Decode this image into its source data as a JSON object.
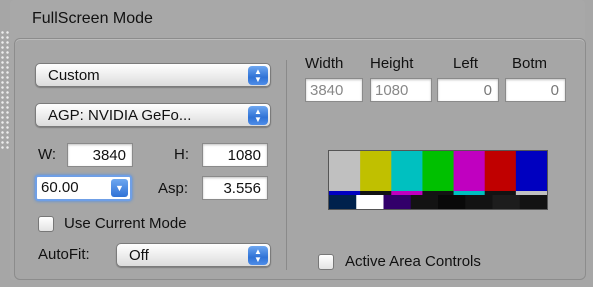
{
  "panel": {
    "title": "FullScreen Mode"
  },
  "mode_popup": {
    "value": "Custom"
  },
  "gpu_popup": {
    "value": "AGP: NVIDIA GeFo..."
  },
  "width": {
    "label": "W:",
    "value": "3840"
  },
  "height": {
    "label": "H:",
    "value": "1080"
  },
  "refresh": {
    "value": "60.00"
  },
  "aspect": {
    "label": "Asp:",
    "value": "3.556"
  },
  "use_current_mode": {
    "label": "Use Current Mode",
    "checked": false
  },
  "autofit": {
    "label": "AutoFit:",
    "value": "Off"
  },
  "columns": {
    "width": "Width",
    "height": "Height",
    "left": "Left",
    "botm": "Botm"
  },
  "column_values": {
    "width": "3840",
    "height": "1080",
    "left": "0",
    "botm": "0"
  },
  "active_area": {
    "label": "Active Area Controls",
    "checked": false
  },
  "color_bars": {
    "top": [
      "#c0c0c0",
      "#c0c000",
      "#00c0c0",
      "#00c000",
      "#c000c0",
      "#c00000",
      "#0000c0"
    ],
    "middle": [
      "#0000c0",
      "#131313",
      "#c000c0",
      "#131313",
      "#00c0c0",
      "#131313",
      "#c0c0c0"
    ],
    "bottom": [
      "#00214c",
      "#ffffff",
      "#32006a",
      "#131313",
      "#090909",
      "#131313",
      "#1d1d1d",
      "#131313"
    ]
  }
}
